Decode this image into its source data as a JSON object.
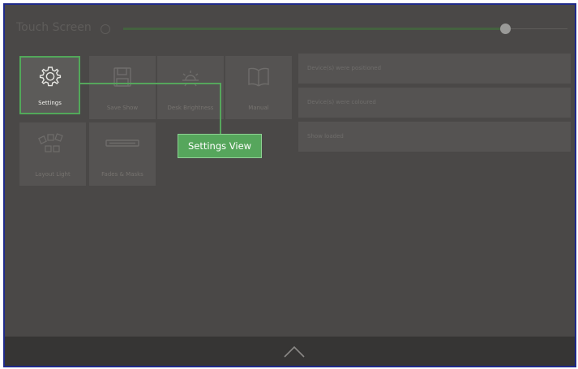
{
  "header": {
    "title": "Touch Screen",
    "brightness": 0.86
  },
  "tiles": [
    {
      "label": "Settings",
      "icon": "gear-icon",
      "active": true
    },
    {
      "label": "Save Show",
      "icon": "floppy-disk-icon",
      "active": false
    },
    {
      "label": "Desk Brightness",
      "icon": "sun-icon",
      "active": false
    },
    {
      "label": "Manual",
      "icon": "book-icon",
      "active": false
    },
    {
      "label": "Layout Light",
      "icon": "fixture-layout-icon",
      "active": false
    },
    {
      "label": "Fades & Masks",
      "icon": "fader-icon",
      "active": false
    }
  ],
  "log": [
    "Device(s) were positioned",
    "Device(s) were coloured",
    "Show loaded"
  ],
  "callout": {
    "label": "Settings View"
  },
  "colors": {
    "accent": "#56a65c",
    "background": "#4a4847",
    "tile": "#555352",
    "bottom_bar": "#363534",
    "frame_border": "#1f2a8a"
  },
  "bottom_bar": {
    "icon": "chevron-up-icon"
  }
}
